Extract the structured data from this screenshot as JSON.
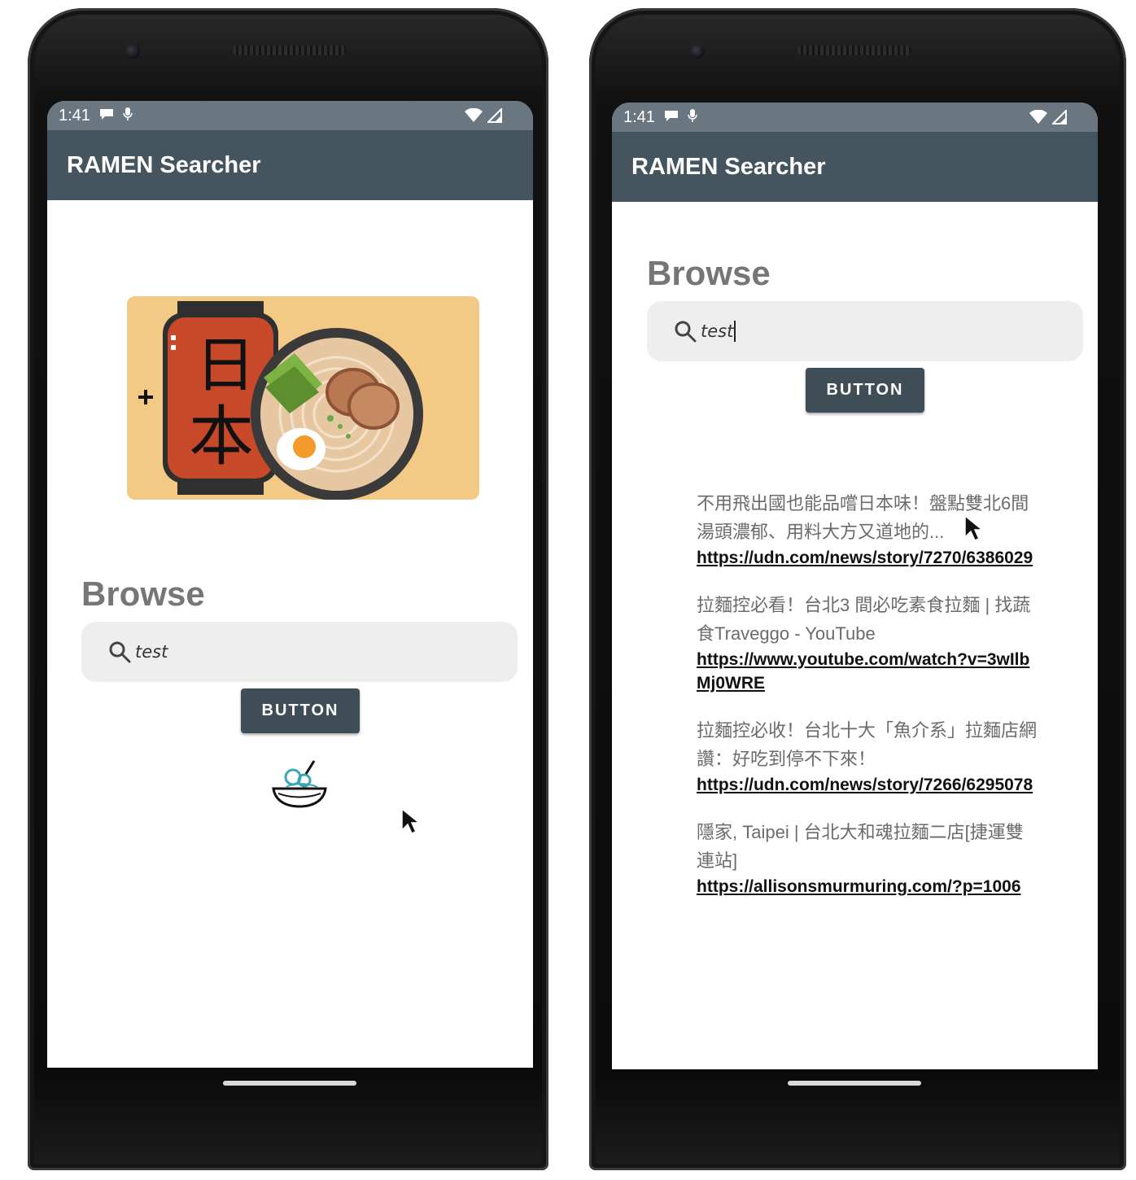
{
  "left_phone": {
    "status": {
      "time": "1:41"
    },
    "app_title": "RAMEN Searcher",
    "hero": {
      "kanji_top": "日",
      "kanji_bottom": "本"
    },
    "browse_title": "Browse",
    "search": {
      "value": "test"
    },
    "button_label": "BUTTON"
  },
  "right_phone": {
    "status": {
      "time": "1:41"
    },
    "app_title": "RAMEN Searcher",
    "browse_title": "Browse",
    "search": {
      "value": "test"
    },
    "button_label": "BUTTON",
    "results": [
      {
        "title": "不用飛出國也能品嚐日本味！盤點雙北6間湯頭濃郁、用料大方又道地的...",
        "url": "https://udn.com/news/story/7270/6386029"
      },
      {
        "title": "拉麵控必看！台北3 間必吃素食拉麵 | 找蔬食Traveggo - YouTube",
        "url": "https://www.youtube.com/watch?v=3wIlbMj0WRE"
      },
      {
        "title": "拉麵控必收！台北十大「魚介系」拉麵店網讚：好吃到停不下來！",
        "url": "https://udn.com/news/story/7266/6295078"
      },
      {
        "title": "隱家, Taipei | 台北大和魂拉麵二店[捷運雙連站]",
        "url": "https://allisonsmurmuring.com/?p=1006"
      }
    ]
  },
  "colors": {
    "status_bar": "#6a7780",
    "app_bar": "#455560",
    "button": "#3f4d57",
    "hero_bg": "#f3c986",
    "lantern": "#c8492a"
  },
  "icons": [
    "message-icon",
    "mic-icon",
    "wifi-icon",
    "signal-icon",
    "search-icon",
    "ramen-bowl-loading-icon",
    "mouse-cursor-icon"
  ]
}
